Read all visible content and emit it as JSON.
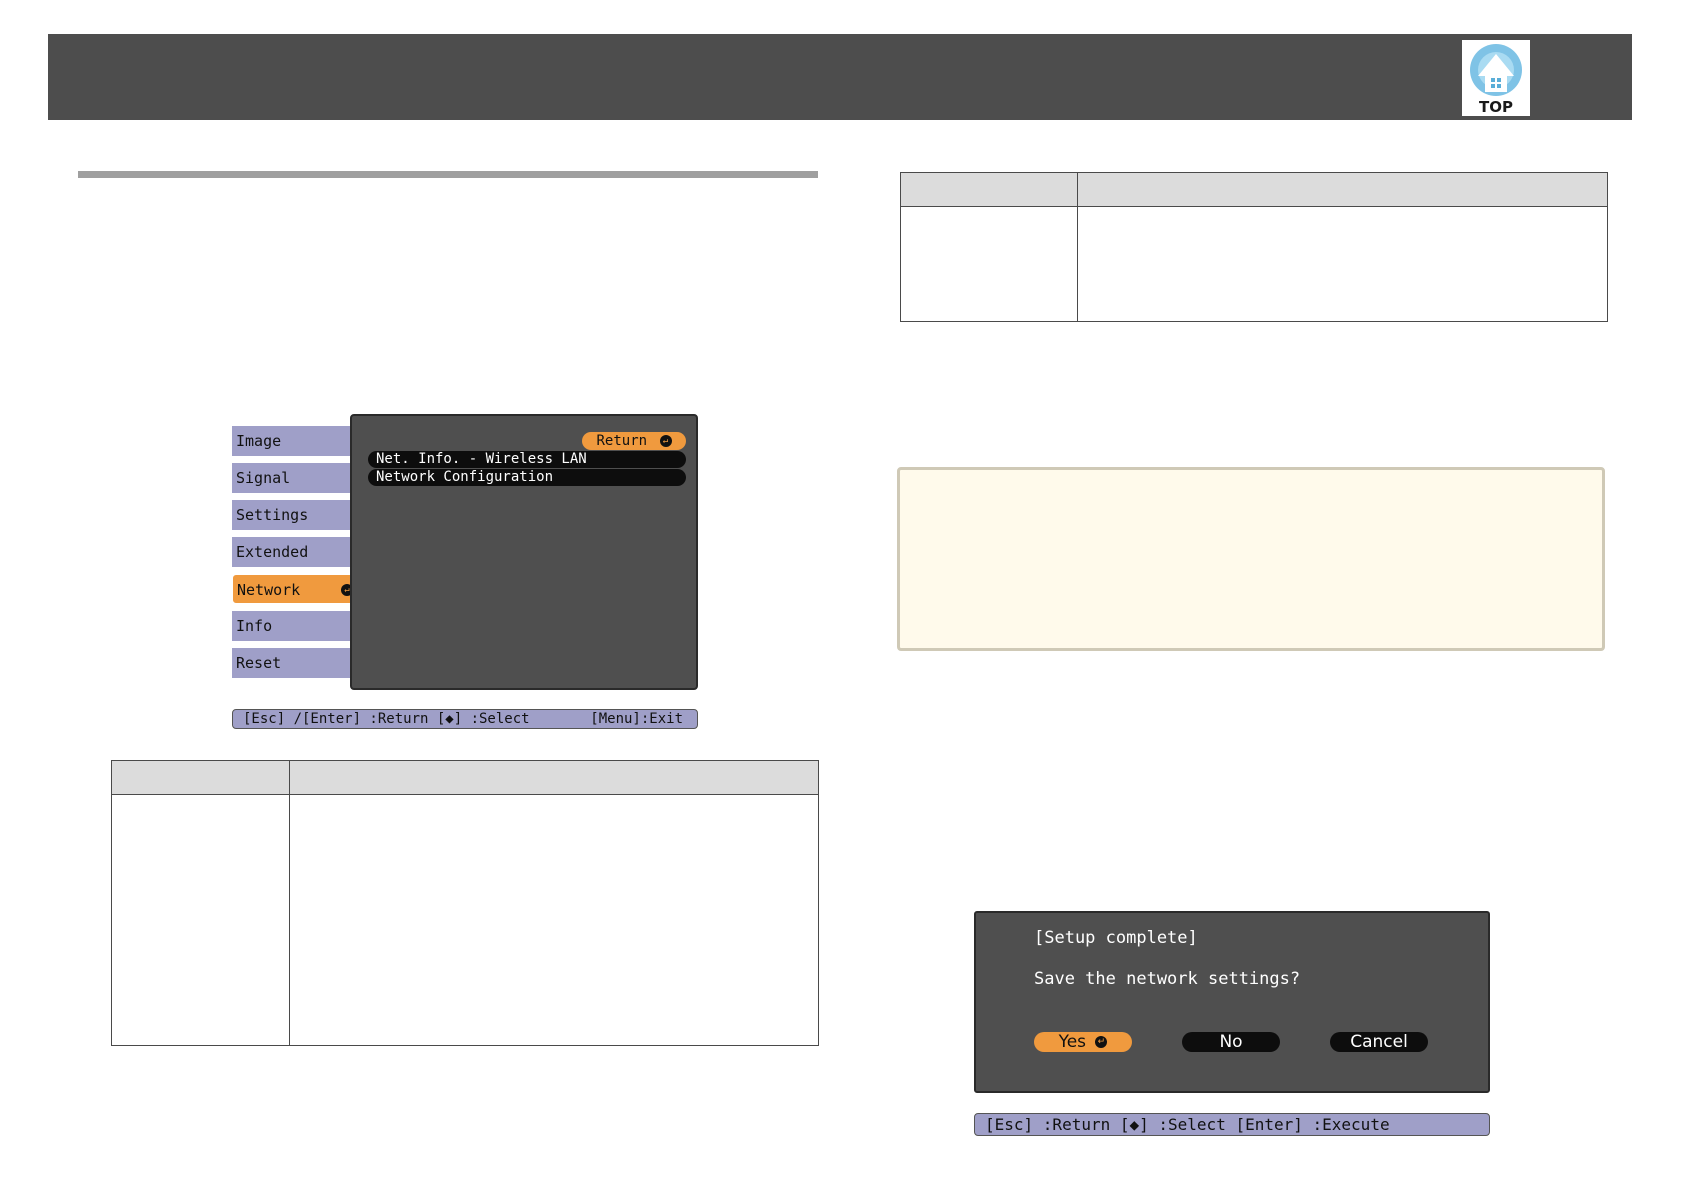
{
  "header": {
    "top_button_label": "TOP"
  },
  "osd_menu": {
    "sidebar": [
      {
        "label": "Image"
      },
      {
        "label": "Signal"
      },
      {
        "label": "Settings"
      },
      {
        "label": "Extended"
      },
      {
        "label": "Network",
        "active": true
      },
      {
        "label": "Info"
      },
      {
        "label": "Reset"
      }
    ],
    "return_label": "Return",
    "rows": [
      "Net. Info. - Wireless LAN",
      "Network Configuration"
    ],
    "help_left": "[Esc] /[Enter] :Return  [◆] :Select",
    "help_right": "[Menu]:Exit",
    "colors": {
      "accent": "#f09a3e",
      "sidebar": "#9f9fc8",
      "panel": "#4f4f4f"
    }
  },
  "setup_dialog": {
    "title": "[Setup complete]",
    "question": "Save the network settings?",
    "yes_label": "Yes",
    "no_label": "No",
    "cancel_label": "Cancel",
    "help": "[Esc] :Return  [◆] :Select  [Enter] :Execute"
  }
}
